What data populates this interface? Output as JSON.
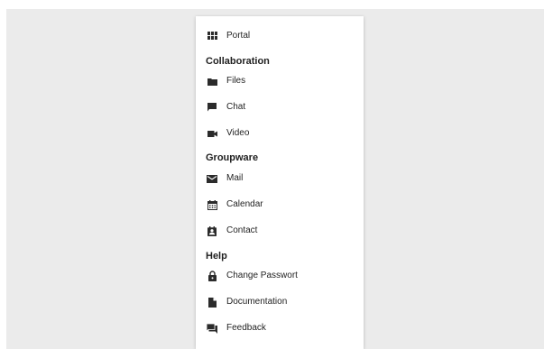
{
  "menu": {
    "items": {
      "portal": {
        "label": "Portal",
        "icon": "apps-grid-icon"
      },
      "files": {
        "label": "Files",
        "icon": "folder-icon"
      },
      "chat": {
        "label": "Chat",
        "icon": "chat-bubble-icon"
      },
      "video": {
        "label": "Video",
        "icon": "video-camera-icon"
      },
      "mail": {
        "label": "Mail",
        "icon": "mail-envelope-icon"
      },
      "calendar": {
        "label": "Calendar",
        "icon": "calendar-icon"
      },
      "contact": {
        "label": "Contact",
        "icon": "contact-card-icon"
      },
      "change_password": {
        "label": "Change Passwort",
        "icon": "lock-icon"
      },
      "documentation": {
        "label": "Documentation",
        "icon": "document-icon"
      },
      "feedback": {
        "label": "Feedback",
        "icon": "feedback-icon"
      }
    },
    "sections": {
      "collaboration": "Collaboration",
      "groupware": "Groupware",
      "help": "Help"
    }
  },
  "theme": {
    "page_bg": "#ffffff",
    "backdrop": "#ebebeb",
    "panel_bg": "#ffffff",
    "icon_color": "#2b2b2b",
    "text_color": "#222222"
  }
}
